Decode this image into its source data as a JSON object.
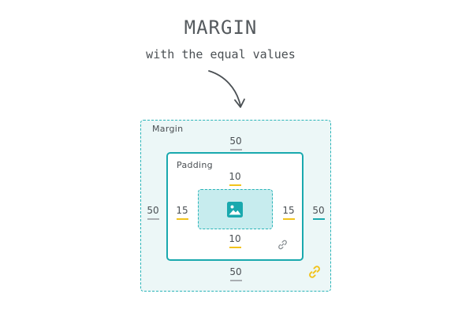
{
  "header": {
    "title": "MARGIN",
    "subtitle": "with the equal values"
  },
  "margin": {
    "label": "Margin",
    "top": "50",
    "bottom": "50",
    "left": "50",
    "right": "50"
  },
  "padding": {
    "label": "Padding",
    "top": "10",
    "bottom": "10",
    "left": "15",
    "right": "15"
  },
  "icons": {
    "content": "image-icon",
    "padding_link": "link-icon",
    "margin_link": "link-icon"
  },
  "colors": {
    "teal": "#19a9ae",
    "margin_fill": "#ecf7f7",
    "content_fill": "#c7ecee",
    "yellow": "#f2c31b",
    "text": "#4a4f53"
  }
}
